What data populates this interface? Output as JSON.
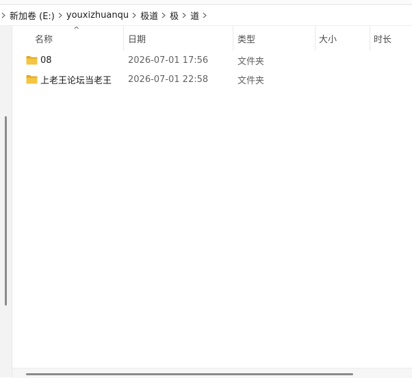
{
  "breadcrumb": {
    "items": [
      "新加卷 (E:)",
      "youxizhuanqu",
      "极道",
      "极",
      "道"
    ],
    "separator_icon": "chevron-right-icon"
  },
  "columns": [
    {
      "label": "名称",
      "sorted": "ascending"
    },
    {
      "label": "日期"
    },
    {
      "label": "类型"
    },
    {
      "label": "大小"
    },
    {
      "label": "时长"
    }
  ],
  "sort_indicator": "^",
  "files": [
    {
      "name": "08",
      "date": "2026-07-01 17:56",
      "type": "文件夹",
      "icon": "folder-icon"
    },
    {
      "name": "上老王论坛当老王",
      "date": "2026-07-01 22:58",
      "type": "文件夹",
      "icon": "folder-icon"
    }
  ],
  "colors": {
    "folder": "#f4c542",
    "folder_dark": "#e2a927",
    "scroll_thumb": "#8a8a8a"
  }
}
